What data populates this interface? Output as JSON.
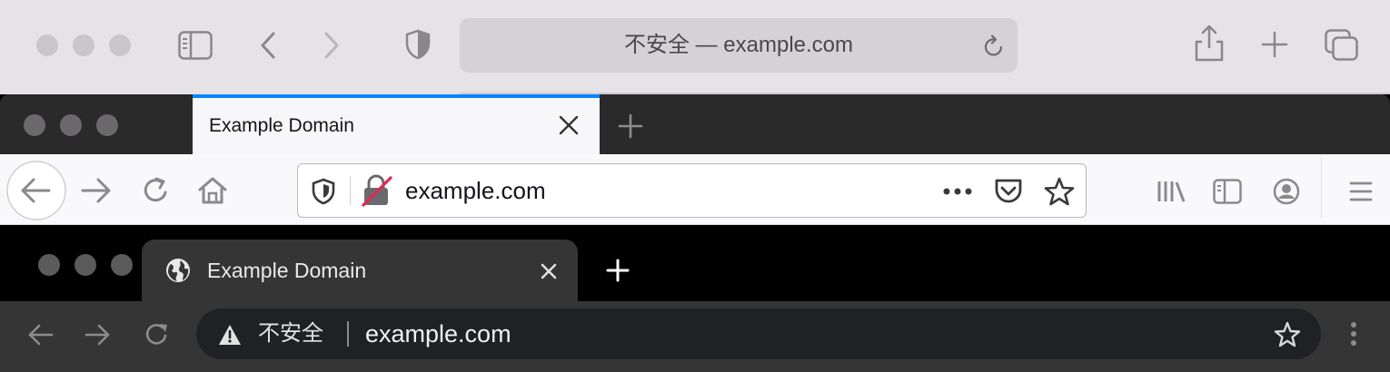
{
  "safari": {
    "address_text": "不安全 — example.com"
  },
  "firefox": {
    "tab_title": "Example Domain",
    "url": "example.com"
  },
  "chrome": {
    "tab_title": "Example Domain",
    "security_label": "不安全",
    "url": "example.com"
  }
}
